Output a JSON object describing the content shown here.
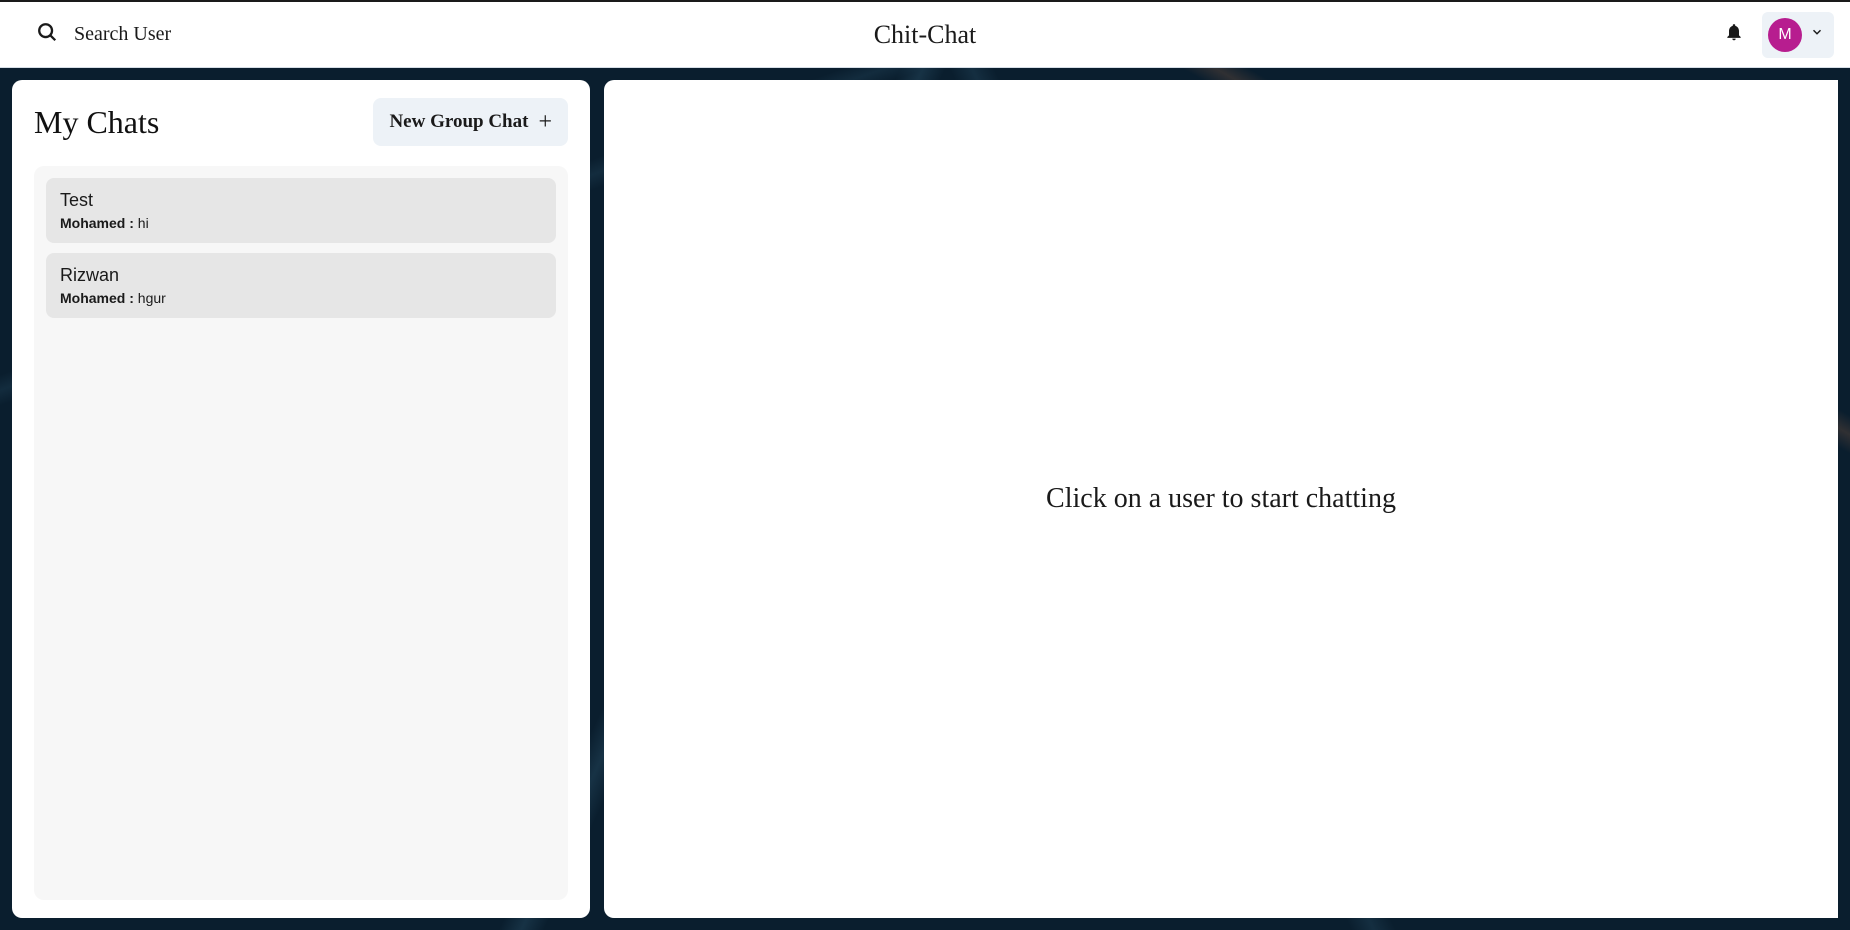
{
  "header": {
    "search_placeholder": "Search User",
    "app_title": "Chit-Chat",
    "avatar_initial": "M"
  },
  "sidebar": {
    "title": "My Chats",
    "new_group_label": "New Group Chat",
    "chats": [
      {
        "name": "Test",
        "sender": "Mohamed",
        "message": "hi"
      },
      {
        "name": "Rizwan",
        "sender": "Mohamed",
        "message": "hgur"
      }
    ]
  },
  "main": {
    "empty_state": "Click on a user to start chatting"
  },
  "colors": {
    "background_dark": "#0a1e2e",
    "avatar_bg": "#b71d8f",
    "panel_bg": "#ffffff",
    "button_bg": "#edf2f7",
    "chat_list_bg": "#f7f7f7",
    "chat_item_bg": "#e6e6e6"
  }
}
